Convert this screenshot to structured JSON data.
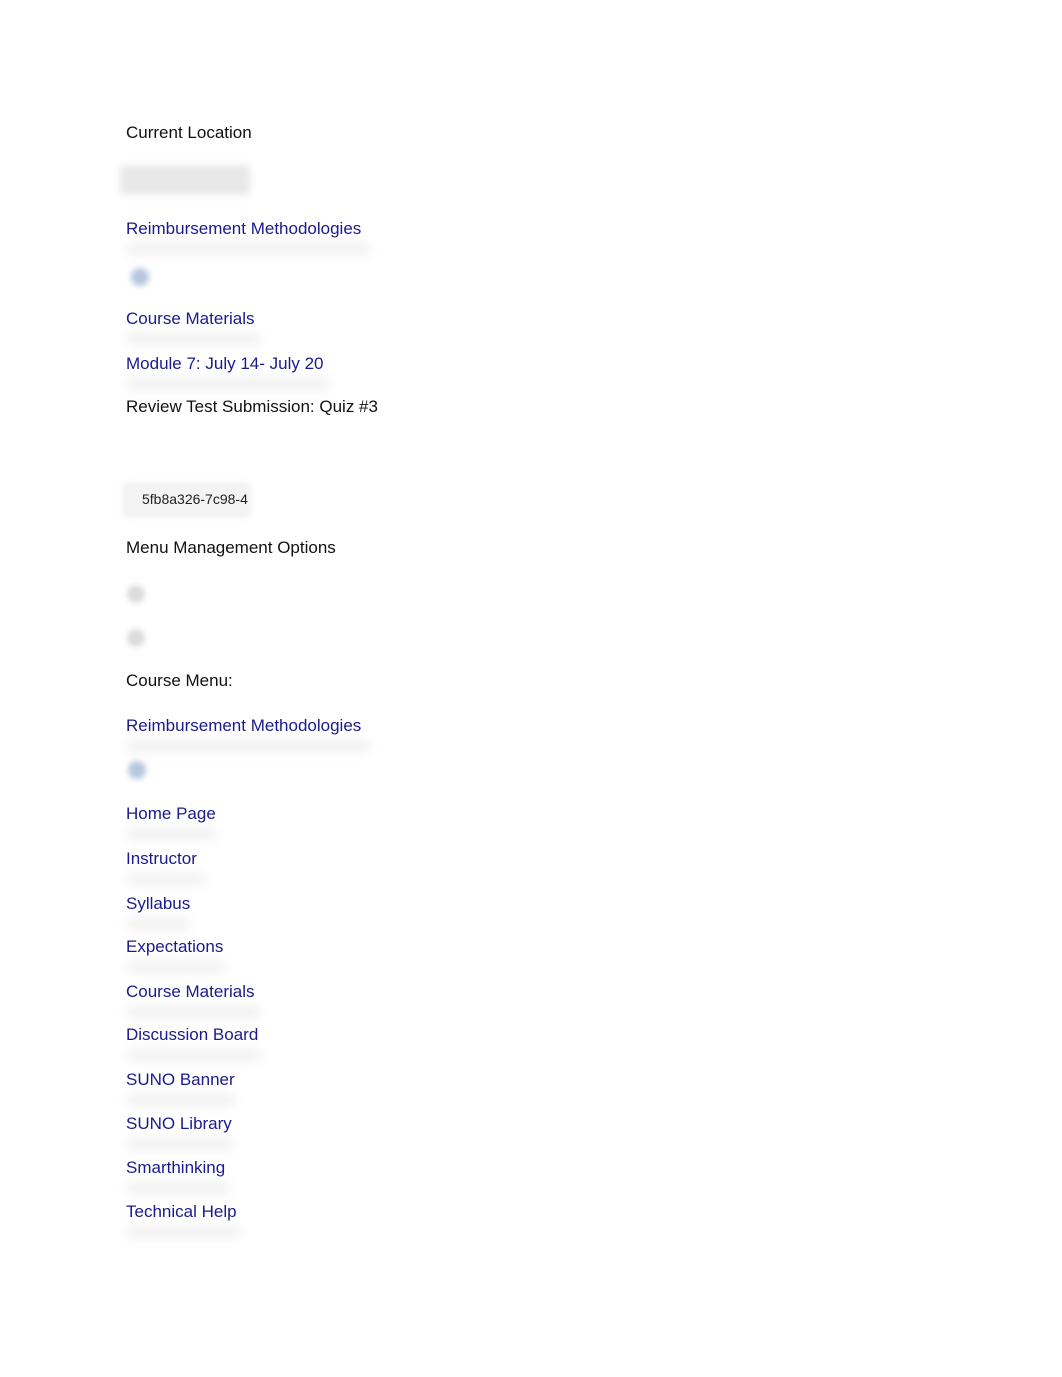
{
  "breadcrumb": {
    "heading": "Current Location",
    "items": [
      {
        "label": "Reimbursement Methodologies",
        "icon": "course-icon"
      },
      {
        "label": "Course Materials"
      },
      {
        "label": "Module 7: July 14- July 20"
      }
    ],
    "current": "Review Test Submission: Quiz #3"
  },
  "session_id": "5fb8a326-7c98-4",
  "menu_management": {
    "heading": "Menu Management Options",
    "icons": [
      "show-menu-icon",
      "hide-menu-icon"
    ]
  },
  "course_menu": {
    "heading": "Course Menu:",
    "course_title": "Reimbursement Methodologies",
    "items": [
      {
        "label": "Home Page"
      },
      {
        "label": "Instructor"
      },
      {
        "label": "Syllabus"
      },
      {
        "label": "Expectations"
      },
      {
        "label": "Course Materials"
      },
      {
        "label": "Discussion Board"
      },
      {
        "label": "SUNO Banner"
      },
      {
        "label": "SUNO Library"
      },
      {
        "label": "Smarthinking"
      },
      {
        "label": "Technical Help"
      }
    ]
  },
  "colors": {
    "link": "#1a1a8c",
    "text": "#111111"
  }
}
